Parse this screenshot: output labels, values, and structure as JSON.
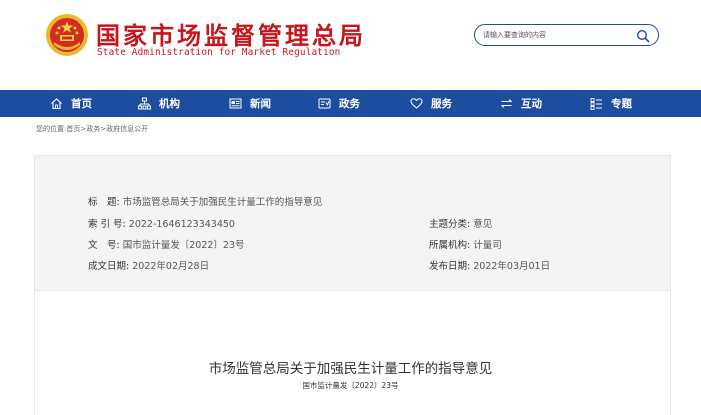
{
  "header": {
    "title": "国家市场监督管理总局",
    "subtitle": "State Administration for Market Regulation",
    "emblem_icon": "national-emblem-icon",
    "brand_color": "#c4161c"
  },
  "search": {
    "placeholder": "请输入要查询的内容",
    "icon": "search-icon"
  },
  "nav": {
    "background": "#1d4d9f",
    "items": [
      {
        "label": "首页",
        "icon": "home-icon"
      },
      {
        "label": "机构",
        "icon": "org-chart-icon"
      },
      {
        "label": "新闻",
        "icon": "news-icon"
      },
      {
        "label": "政务",
        "icon": "government-affairs-icon"
      },
      {
        "label": "服务",
        "icon": "heart-icon"
      },
      {
        "label": "互动",
        "icon": "exchange-icon"
      },
      {
        "label": "专题",
        "icon": "topic-icon"
      }
    ]
  },
  "breadcrumb": {
    "prefix": "您的位置:",
    "items": [
      "首页",
      "政务",
      "政府信息公开"
    ],
    "separator": ">"
  },
  "meta": {
    "title_label": "标　题:",
    "title_value": "市场监管总局关于加强民生计量工作的指导意见",
    "index_label": "索 引 号:",
    "index_value": "2022-1646123343450",
    "category_label": "主题分类:",
    "category_value": "意见",
    "docno_label": "文　号:",
    "docno_value": "国市监计量发〔2022〕23号",
    "org_label": "所属机构:",
    "org_value": "计量司",
    "created_label": "成文日期:",
    "created_value": "2022年02月28日",
    "published_label": "发布日期:",
    "published_value": "2022年03月01日"
  },
  "document": {
    "title": "市场监管总局关于加强民生计量工作的指导意见",
    "number": "国市监计量发〔2022〕23号"
  }
}
